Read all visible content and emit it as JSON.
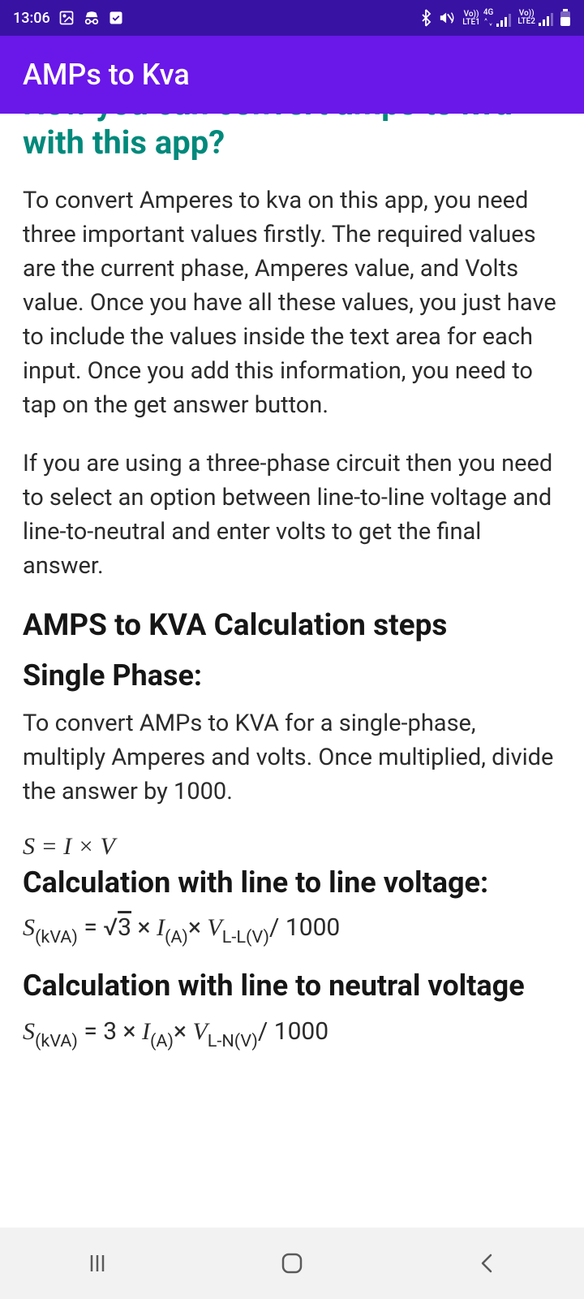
{
  "status": {
    "time": "13:06",
    "icons": {
      "image": "image-icon",
      "incognito": "incognito-icon",
      "check": "check-icon",
      "bluetooth": "bluetooth-icon",
      "mute": "mute-vibrate-icon",
      "battery": "battery-icon"
    },
    "sim1": {
      "top": "Vo))",
      "mid": "LTE1",
      "net": "4G"
    },
    "sim2": {
      "top": "Vo))",
      "mid": "LTE2"
    }
  },
  "appbar": {
    "title": "AMPs to Kva"
  },
  "content": {
    "heading_cut": "How you can convert amps to kva with this app?",
    "para1": "To convert Amperes to kva on this app, you need three important values firstly. The required values are the current phase, Amperes value, and Volts value. Once you have all these values, you just have to include the values inside the text area for each input. Once you add this information, you need to tap on the get answer button.",
    "para2": "If you are using a three-phase circuit then you need to select an option between line-to-line voltage and line-to-neutral and enter volts to get the final answer.",
    "steps_heading": "AMPS to KVA Calculation steps",
    "single_phase_heading": "Single Phase:",
    "single_phase_para": "To convert AMPs to KVA for a single-phase, multiply Amperes and volts. Once multiplied, divide the answer by 1000.",
    "formula_single": "S = I × V",
    "ll_heading": "Calculation with line to line voltage:",
    "formula_ll": {
      "s": "S",
      "s_sub": "(kVA)",
      "eq": " = ",
      "root": "√",
      "rootval": "3",
      "times1": " × ",
      "i": "I",
      "i_sub": "(A)",
      "times2": "× ",
      "v": "V",
      "v_sub": "L-L(V)",
      "div": "/ 1000"
    },
    "ln_heading": "Calculation with line to neutral voltage",
    "formula_ln": {
      "s": "S",
      "s_sub": "(kVA)",
      "eq": " = 3 × ",
      "i": "I",
      "i_sub": "(A)",
      "times2": "× ",
      "v": "V",
      "v_sub": "L-N(V)",
      "div": "/ 1000"
    }
  },
  "nav": {
    "recents": "recents-button",
    "home": "home-button",
    "back": "back-button"
  }
}
